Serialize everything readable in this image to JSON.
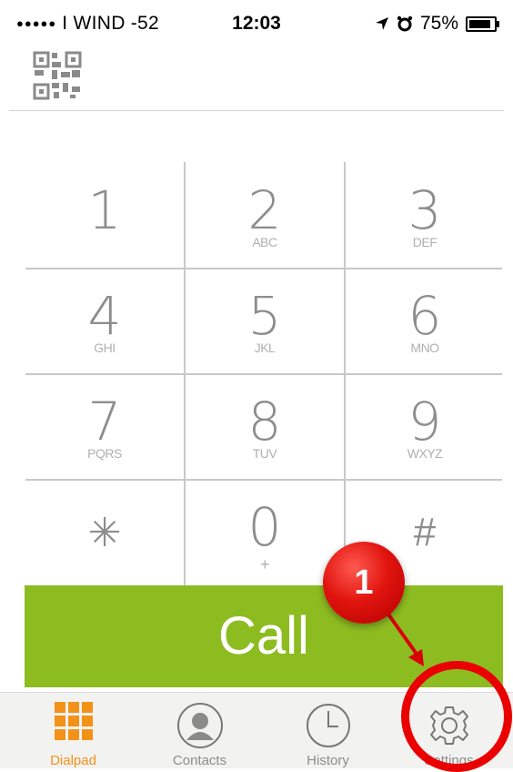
{
  "status_bar": {
    "carrier": "I WIND",
    "signal": "-52",
    "time": "12:03",
    "battery": "75%"
  },
  "dialpad": {
    "keys": [
      {
        "digit": "1",
        "letters": ""
      },
      {
        "digit": "2",
        "letters": "ABC"
      },
      {
        "digit": "3",
        "letters": "DEF"
      },
      {
        "digit": "4",
        "letters": "GHI"
      },
      {
        "digit": "5",
        "letters": "JKL"
      },
      {
        "digit": "6",
        "letters": "MNO"
      },
      {
        "digit": "7",
        "letters": "PQRS"
      },
      {
        "digit": "8",
        "letters": "TUV"
      },
      {
        "digit": "9",
        "letters": "WXYZ"
      },
      {
        "digit": "✳",
        "letters": ""
      },
      {
        "digit": "0",
        "letters": "+"
      },
      {
        "digit": "#",
        "letters": ""
      }
    ]
  },
  "call_button": {
    "label": "Call",
    "color": "#8dbc21"
  },
  "tabs": [
    {
      "label": "Dialpad",
      "icon": "grid-icon",
      "active": true
    },
    {
      "label": "Contacts",
      "icon": "person-icon",
      "active": false
    },
    {
      "label": "History",
      "icon": "clock-icon",
      "active": false
    },
    {
      "label": "Settings",
      "icon": "gear-icon",
      "active": false
    }
  ],
  "annotation": {
    "step": "1",
    "color": "#ea0000"
  },
  "colors": {
    "accent": "#f39219",
    "call_green": "#8dbc21"
  }
}
